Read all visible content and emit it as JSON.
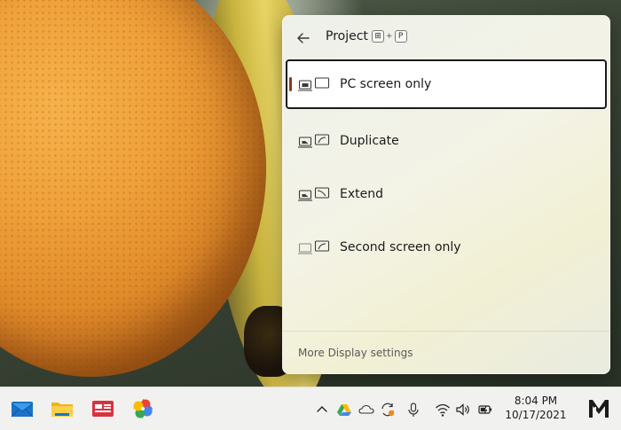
{
  "flyout": {
    "title": "Project",
    "shortcut": [
      "⊞",
      "+",
      "P"
    ],
    "options": [
      {
        "label": "PC screen only",
        "icon": "pc-screen-only-icon",
        "selected": true
      },
      {
        "label": "Duplicate",
        "icon": "duplicate-icon",
        "selected": false
      },
      {
        "label": "Extend",
        "icon": "extend-icon",
        "selected": false
      },
      {
        "label": "Second screen only",
        "icon": "second-screen-only-icon",
        "selected": false
      }
    ],
    "more_link": "More Display settings"
  },
  "taskbar": {
    "apps": [
      "mail-icon",
      "file-explorer-icon",
      "news-icon",
      "photos-icon"
    ],
    "tray": [
      "chevron-up-icon",
      "google-drive-icon",
      "onedrive-icon",
      "sync-icon",
      "microphone-icon",
      "wifi-icon",
      "volume-icon",
      "battery-icon"
    ],
    "clock": {
      "time": "8:04 PM",
      "date": "10/17/2021"
    }
  },
  "colors": {
    "selection_accent": "#8a3b1e",
    "flyout_bg": "#f1f1e6"
  }
}
